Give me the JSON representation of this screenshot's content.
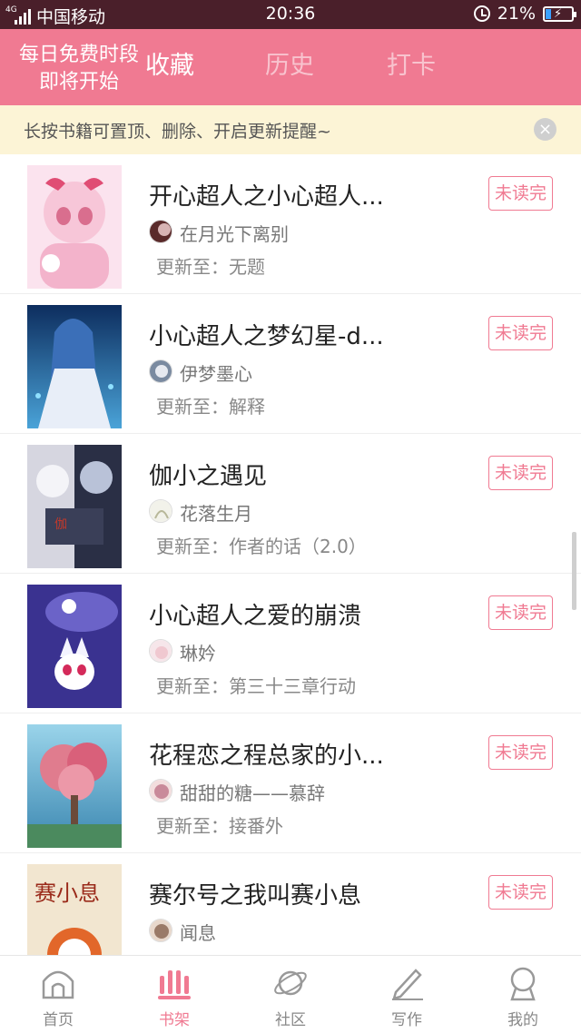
{
  "status": {
    "network": "4G",
    "carrier": "中国移动",
    "time": "20:36",
    "battery_pct": "21%",
    "battery_level": 0.21
  },
  "header": {
    "promo_line1": "每日免费时段",
    "promo_line2": "即将开始",
    "tabs": [
      {
        "label": "收藏",
        "active": true
      },
      {
        "label": "历史",
        "active": false
      },
      {
        "label": "打卡",
        "active": false
      }
    ],
    "colors": {
      "brand": "#f07a92"
    }
  },
  "tip": {
    "text": "长按书籍可置顶、删除、开启更新提醒~",
    "close_icon": "×"
  },
  "books": [
    {
      "title": "开心超人之小心超人...",
      "author": "在月光下离别",
      "update": "更新至：无题",
      "badge": "未读完",
      "cover_colors": [
        "#f7c6d8",
        "#fbe3ee"
      ]
    },
    {
      "title": "小心超人之梦幻星-d...",
      "author": "伊梦墨心",
      "update": "更新至：解释",
      "badge": "未读完",
      "cover_colors": [
        "#1c4f8e",
        "#7fbde8"
      ]
    },
    {
      "title": "伽小之遇见",
      "author": "花落生月",
      "update": "更新至：作者的话（2.0）",
      "badge": "未读完",
      "cover_colors": [
        "#2a2f45",
        "#c9c9d6"
      ]
    },
    {
      "title": "小心超人之爱的崩溃",
      "author": "琳妗",
      "update": "更新至：第三十三章行动",
      "badge": "未读完",
      "cover_colors": [
        "#3a3290",
        "#6b63c8"
      ]
    },
    {
      "title": "花程恋之程总家的小...",
      "author": "甜甜的糖——慕辞",
      "update": "更新至：接番外",
      "badge": "未读完",
      "cover_colors": [
        "#e07c8e",
        "#7fc6e0"
      ]
    },
    {
      "title": "赛尔号之我叫赛小息",
      "author": "闻息",
      "update": "",
      "badge": "未读完",
      "cover_colors": [
        "#f2e6d0",
        "#c0392b"
      ]
    }
  ],
  "nav": [
    {
      "label": "首页",
      "icon": "home-icon",
      "active": false
    },
    {
      "label": "书架",
      "icon": "bookshelf-icon",
      "active": true
    },
    {
      "label": "社区",
      "icon": "planet-icon",
      "active": false
    },
    {
      "label": "写作",
      "icon": "pen-icon",
      "active": false
    },
    {
      "label": "我的",
      "icon": "profile-icon",
      "active": false
    }
  ]
}
